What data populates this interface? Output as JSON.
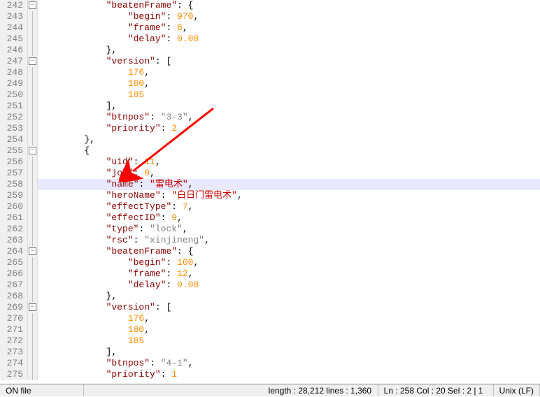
{
  "lines": [
    {
      "n": 242,
      "fold": "minus",
      "indent": 3,
      "tokens": [
        {
          "t": "key",
          "v": "\"beatenFrame\""
        },
        {
          "t": "punct",
          "v": ": {"
        }
      ]
    },
    {
      "n": 243,
      "fold": "line",
      "indent": 4,
      "tokens": [
        {
          "t": "key",
          "v": "\"begin\""
        },
        {
          "t": "punct",
          "v": ": "
        },
        {
          "t": "number",
          "v": "970"
        },
        {
          "t": "punct",
          "v": ","
        }
      ]
    },
    {
      "n": 244,
      "fold": "line",
      "indent": 4,
      "tokens": [
        {
          "t": "key",
          "v": "\"frame\""
        },
        {
          "t": "punct",
          "v": ": "
        },
        {
          "t": "number",
          "v": "6"
        },
        {
          "t": "punct",
          "v": ","
        }
      ]
    },
    {
      "n": 245,
      "fold": "line",
      "indent": 4,
      "tokens": [
        {
          "t": "key",
          "v": "\"delay\""
        },
        {
          "t": "punct",
          "v": ": "
        },
        {
          "t": "number",
          "v": "0.08"
        }
      ]
    },
    {
      "n": 246,
      "fold": "line",
      "indent": 3,
      "tokens": [
        {
          "t": "punct",
          "v": "},"
        }
      ]
    },
    {
      "n": 247,
      "fold": "minus",
      "indent": 3,
      "tokens": [
        {
          "t": "key",
          "v": "\"version\""
        },
        {
          "t": "punct",
          "v": ": ["
        }
      ]
    },
    {
      "n": 248,
      "fold": "line",
      "indent": 4,
      "tokens": [
        {
          "t": "number",
          "v": "176"
        },
        {
          "t": "punct",
          "v": ","
        }
      ]
    },
    {
      "n": 249,
      "fold": "line",
      "indent": 4,
      "tokens": [
        {
          "t": "number",
          "v": "180"
        },
        {
          "t": "punct",
          "v": ","
        }
      ]
    },
    {
      "n": 250,
      "fold": "line",
      "indent": 4,
      "tokens": [
        {
          "t": "number",
          "v": "185"
        }
      ]
    },
    {
      "n": 251,
      "fold": "line",
      "indent": 3,
      "tokens": [
        {
          "t": "punct",
          "v": "],"
        }
      ]
    },
    {
      "n": 252,
      "fold": "line",
      "indent": 3,
      "tokens": [
        {
          "t": "key",
          "v": "\"btnpos\""
        },
        {
          "t": "punct",
          "v": ": "
        },
        {
          "t": "string",
          "v": "\"3-3\""
        },
        {
          "t": "punct",
          "v": ","
        }
      ]
    },
    {
      "n": 253,
      "fold": "line",
      "indent": 3,
      "tokens": [
        {
          "t": "key",
          "v": "\"priority\""
        },
        {
          "t": "punct",
          "v": ": "
        },
        {
          "t": "number",
          "v": "2"
        }
      ]
    },
    {
      "n": 254,
      "fold": "line",
      "indent": 2,
      "tokens": [
        {
          "t": "punct",
          "v": "},"
        }
      ]
    },
    {
      "n": 255,
      "fold": "minus",
      "indent": 2,
      "tokens": [
        {
          "t": "punct",
          "v": "{"
        }
      ]
    },
    {
      "n": 256,
      "fold": "line",
      "indent": 3,
      "tokens": [
        {
          "t": "key",
          "v": "\"uid\""
        },
        {
          "t": "punct",
          "v": ": "
        },
        {
          "t": "number",
          "v": "11"
        },
        {
          "t": "punct",
          "v": ","
        }
      ]
    },
    {
      "n": 257,
      "fold": "line",
      "indent": 3,
      "tokens": [
        {
          "t": "key",
          "v": "\"job\""
        },
        {
          "t": "punct",
          "v": ": "
        },
        {
          "t": "number",
          "v": "0"
        },
        {
          "t": "punct",
          "v": ","
        }
      ]
    },
    {
      "n": 258,
      "fold": "line",
      "hl": true,
      "indent": 3,
      "tokens": [
        {
          "t": "key",
          "v": "\"name\""
        },
        {
          "t": "punct",
          "v": ": "
        },
        {
          "t": "string-cn",
          "v": "\"雷电术\""
        },
        {
          "t": "punct",
          "v": ","
        }
      ]
    },
    {
      "n": 259,
      "fold": "line",
      "indent": 3,
      "tokens": [
        {
          "t": "key",
          "v": "\"heroName\""
        },
        {
          "t": "punct",
          "v": ": "
        },
        {
          "t": "string-cn",
          "v": "\"白日门雷电术\""
        },
        {
          "t": "punct",
          "v": ","
        }
      ]
    },
    {
      "n": 260,
      "fold": "line",
      "indent": 3,
      "tokens": [
        {
          "t": "key",
          "v": "\"effectType\""
        },
        {
          "t": "punct",
          "v": ": "
        },
        {
          "t": "number",
          "v": "7"
        },
        {
          "t": "punct",
          "v": ","
        }
      ]
    },
    {
      "n": 261,
      "fold": "line",
      "indent": 3,
      "tokens": [
        {
          "t": "key",
          "v": "\"effectID\""
        },
        {
          "t": "punct",
          "v": ": "
        },
        {
          "t": "number",
          "v": "9"
        },
        {
          "t": "punct",
          "v": ","
        }
      ]
    },
    {
      "n": 262,
      "fold": "line",
      "indent": 3,
      "tokens": [
        {
          "t": "key",
          "v": "\"type\""
        },
        {
          "t": "punct",
          "v": ": "
        },
        {
          "t": "string",
          "v": "\"lock\""
        },
        {
          "t": "punct",
          "v": ","
        }
      ]
    },
    {
      "n": 263,
      "fold": "line",
      "indent": 3,
      "tokens": [
        {
          "t": "key",
          "v": "\"rsc\""
        },
        {
          "t": "punct",
          "v": ": "
        },
        {
          "t": "string",
          "v": "\"xinjineng\""
        },
        {
          "t": "punct",
          "v": ","
        }
      ]
    },
    {
      "n": 264,
      "fold": "minus",
      "indent": 3,
      "tokens": [
        {
          "t": "key",
          "v": "\"beatenFrame\""
        },
        {
          "t": "punct",
          "v": ": {"
        }
      ]
    },
    {
      "n": 265,
      "fold": "line",
      "indent": 4,
      "tokens": [
        {
          "t": "key",
          "v": "\"begin\""
        },
        {
          "t": "punct",
          "v": ": "
        },
        {
          "t": "number",
          "v": "100"
        },
        {
          "t": "punct",
          "v": ","
        }
      ]
    },
    {
      "n": 266,
      "fold": "line",
      "indent": 4,
      "tokens": [
        {
          "t": "key",
          "v": "\"frame\""
        },
        {
          "t": "punct",
          "v": ": "
        },
        {
          "t": "number",
          "v": "12"
        },
        {
          "t": "punct",
          "v": ","
        }
      ]
    },
    {
      "n": 267,
      "fold": "line",
      "indent": 4,
      "tokens": [
        {
          "t": "key",
          "v": "\"delay\""
        },
        {
          "t": "punct",
          "v": ": "
        },
        {
          "t": "number",
          "v": "0.08"
        }
      ]
    },
    {
      "n": 268,
      "fold": "line",
      "indent": 3,
      "tokens": [
        {
          "t": "punct",
          "v": "},"
        }
      ]
    },
    {
      "n": 269,
      "fold": "minus",
      "indent": 3,
      "tokens": [
        {
          "t": "key",
          "v": "\"version\""
        },
        {
          "t": "punct",
          "v": ": ["
        }
      ]
    },
    {
      "n": 270,
      "fold": "line",
      "indent": 4,
      "tokens": [
        {
          "t": "number",
          "v": "176"
        },
        {
          "t": "punct",
          "v": ","
        }
      ]
    },
    {
      "n": 271,
      "fold": "line",
      "indent": 4,
      "tokens": [
        {
          "t": "number",
          "v": "180"
        },
        {
          "t": "punct",
          "v": ","
        }
      ]
    },
    {
      "n": 272,
      "fold": "line",
      "indent": 4,
      "tokens": [
        {
          "t": "number",
          "v": "185"
        }
      ]
    },
    {
      "n": 273,
      "fold": "line",
      "indent": 3,
      "tokens": [
        {
          "t": "punct",
          "v": "],"
        }
      ]
    },
    {
      "n": 274,
      "fold": "line",
      "indent": 3,
      "tokens": [
        {
          "t": "key",
          "v": "\"btnpos\""
        },
        {
          "t": "punct",
          "v": ": "
        },
        {
          "t": "string",
          "v": "\"4-1\""
        },
        {
          "t": "punct",
          "v": ","
        }
      ]
    },
    {
      "n": 275,
      "fold": "line",
      "indent": 3,
      "tokens": [
        {
          "t": "key",
          "v": "\"priority\""
        },
        {
          "t": "punct",
          "v": ": "
        },
        {
          "t": "number",
          "v": "1"
        }
      ]
    }
  ],
  "statusbar": {
    "file": "ON file",
    "length": "length : 28,212    lines : 1,360",
    "position": "Ln : 258    Col : 20    Sel : 2 | 1",
    "encoding": "Unix (LF)"
  }
}
